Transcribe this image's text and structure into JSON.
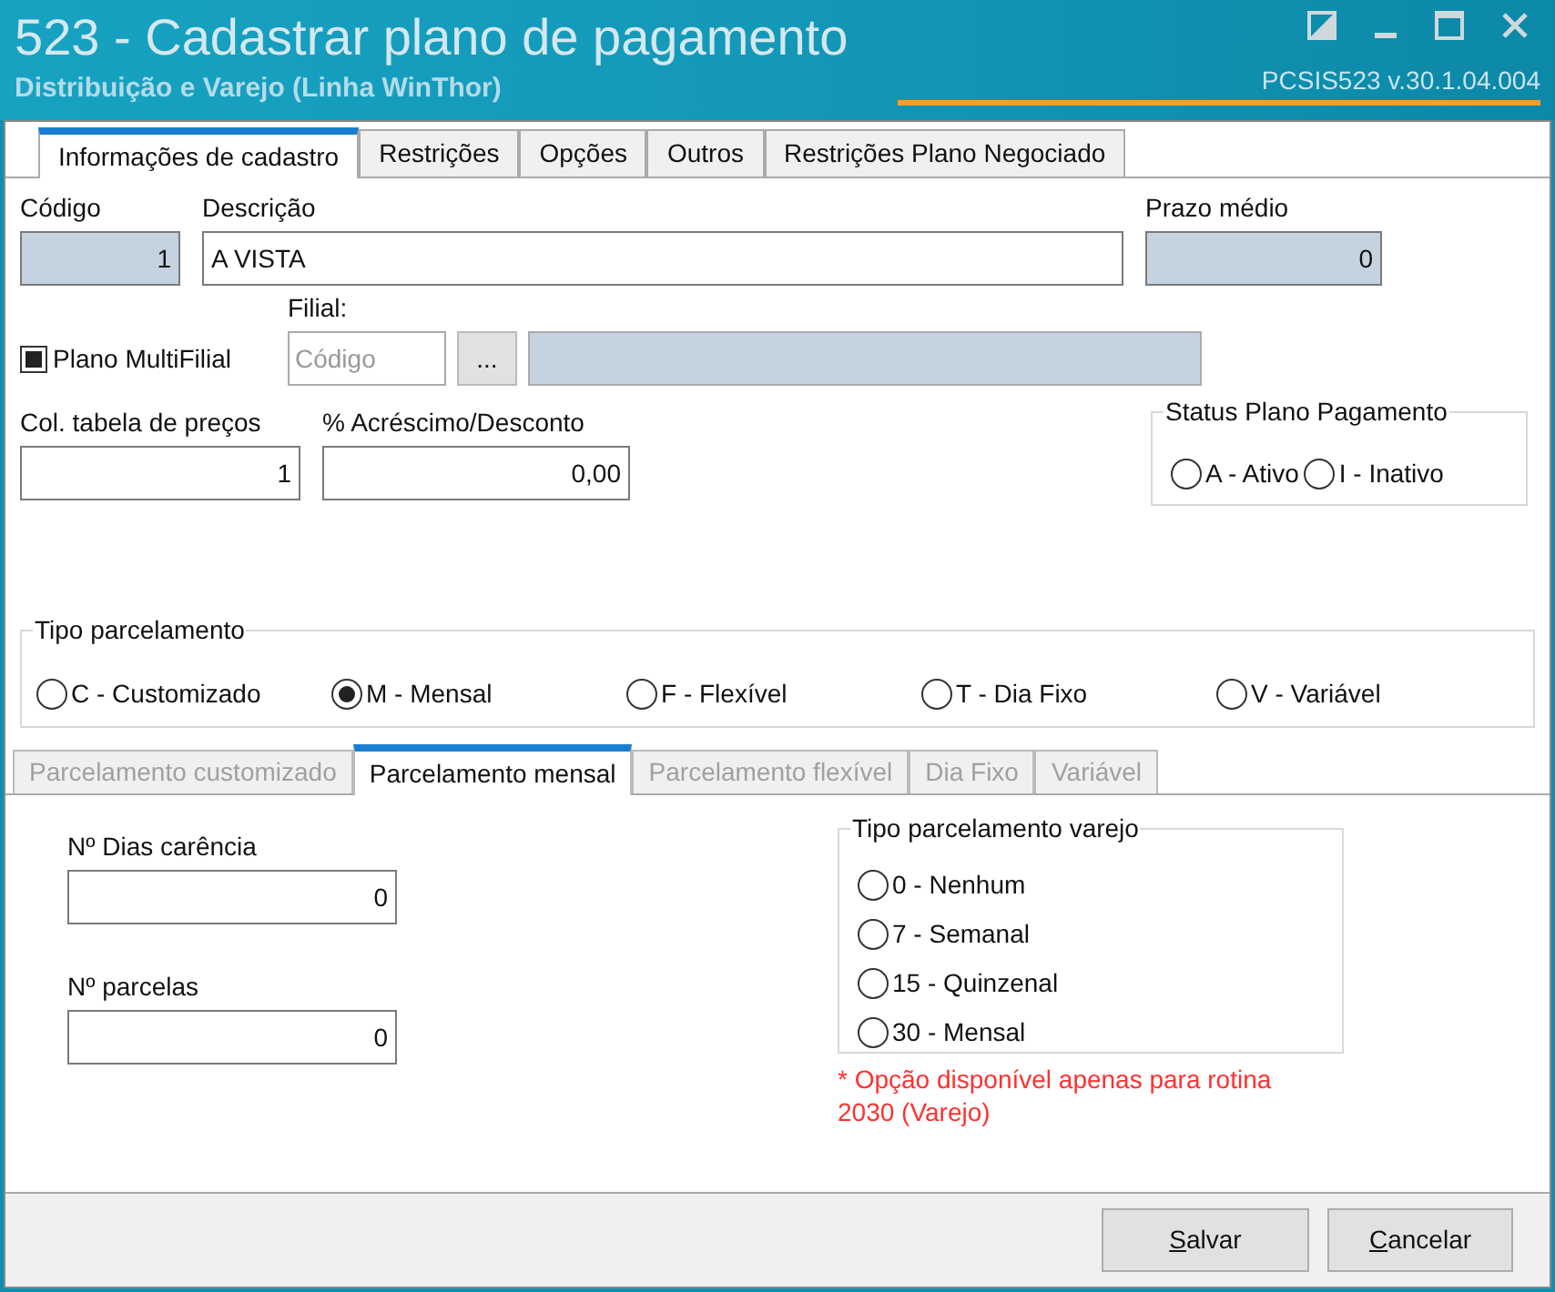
{
  "window": {
    "title": "523 - Cadastrar plano de pagamento",
    "subtitle": "Distribuição e Varejo (Linha WinThor)",
    "version": "PCSIS523  v.30.1.04.004"
  },
  "tabs": [
    {
      "label": "Informações de cadastro",
      "selected": true
    },
    {
      "label": "Restrições",
      "selected": false
    },
    {
      "label": "Opções",
      "selected": false
    },
    {
      "label": "Outros",
      "selected": false
    },
    {
      "label": "Restrições Plano Negociado",
      "selected": false
    }
  ],
  "codigo": {
    "label": "Código",
    "value": "1"
  },
  "descricao": {
    "label": "Descrição",
    "value": "A VISTA"
  },
  "prazo_medio": {
    "label": "Prazo médio",
    "value": "0"
  },
  "multifilial": {
    "label": "Plano MultiFilial",
    "checked": true
  },
  "filial": {
    "label": "Filial:",
    "placeholder": "Código",
    "button": "..."
  },
  "col_tabela": {
    "label": "Col. tabela de preços",
    "value": "1"
  },
  "acrescimo": {
    "label": "% Acréscimo/Desconto",
    "value": "0,00"
  },
  "status": {
    "title": "Status Plano Pagamento",
    "options": [
      {
        "label": "A - Ativo",
        "selected": false
      },
      {
        "label": "I - Inativo",
        "selected": false
      }
    ]
  },
  "tipo_parcelamento": {
    "title": "Tipo parcelamento",
    "options": [
      {
        "label": "C - Customizado",
        "selected": false
      },
      {
        "label": "M - Mensal",
        "selected": true
      },
      {
        "label": "F - Flexível",
        "selected": false
      },
      {
        "label": "T - Dia Fixo",
        "selected": false
      },
      {
        "label": "V - Variável",
        "selected": false
      }
    ]
  },
  "subtabs": [
    {
      "label": "Parcelamento customizado",
      "selected": false,
      "disabled": true
    },
    {
      "label": "Parcelamento mensal",
      "selected": true,
      "disabled": false
    },
    {
      "label": "Parcelamento flexível",
      "selected": false,
      "disabled": true
    },
    {
      "label": "Dia Fixo",
      "selected": false,
      "disabled": true
    },
    {
      "label": "Variável",
      "selected": false,
      "disabled": true
    }
  ],
  "dias_carencia": {
    "label": "Nº Dias carência",
    "value": "0"
  },
  "parcelas": {
    "label": "Nº parcelas",
    "value": "0"
  },
  "tipo_varejo": {
    "title": "Tipo parcelamento varejo",
    "options": [
      {
        "label": "0 - Nenhum",
        "selected": false
      },
      {
        "label": "7 - Semanal",
        "selected": false
      },
      {
        "label": "15 - Quinzenal",
        "selected": false
      },
      {
        "label": "30 - Mensal",
        "selected": false
      }
    ]
  },
  "note": "* Opção disponível apenas para rotina 2030 (Varejo)",
  "buttons": [
    "Salvar",
    "Cancelar"
  ]
}
